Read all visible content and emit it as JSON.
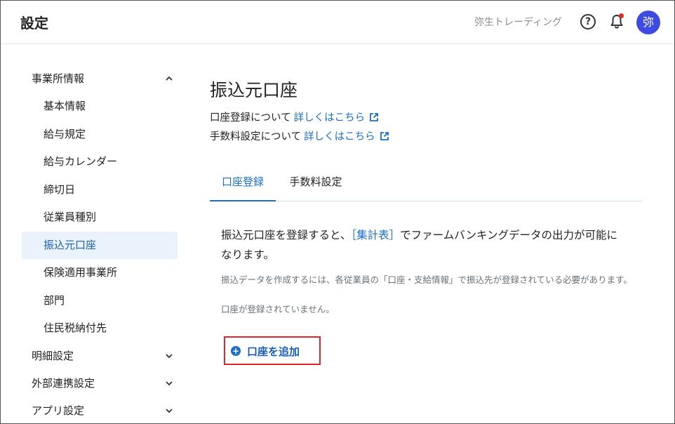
{
  "header": {
    "title": "設定",
    "company": "弥生トレーディング",
    "help_glyph": "?",
    "avatar_initial": "弥",
    "colors": {
      "avatar": "#3d4be0",
      "notification_dot": "#e0262c"
    }
  },
  "sidebar": {
    "groups": [
      {
        "label": "事業所情報",
        "expanded": true,
        "items": [
          {
            "label": "基本情報"
          },
          {
            "label": "給与規定"
          },
          {
            "label": "給与カレンダー"
          },
          {
            "label": "締切日"
          },
          {
            "label": "従業員種別"
          },
          {
            "label": "振込元口座",
            "active": true
          },
          {
            "label": "保険適用事業所"
          },
          {
            "label": "部門"
          },
          {
            "label": "住民税納付先"
          }
        ]
      },
      {
        "label": "明細設定",
        "expanded": false
      },
      {
        "label": "外部連携設定",
        "expanded": false
      },
      {
        "label": "アプリ設定",
        "expanded": false
      }
    ]
  },
  "main": {
    "title": "振込元口座",
    "info_lines": [
      {
        "text": "口座登録について",
        "link": "詳しくはこちら"
      },
      {
        "text": "手数料設定について",
        "link": "詳しくはこちら"
      }
    ],
    "tabs": [
      {
        "label": "口座登録",
        "active": true
      },
      {
        "label": "手数料設定",
        "active": false
      }
    ],
    "description_prefix": "振込元口座を登録すると、",
    "description_bracket": "［集計表］",
    "description_suffix": "でファームバンキングデータの出力が可能になります。",
    "note": "振込データを作成するには、各従業員の「口座・支給情報」で振込先が登録されている必要があります。",
    "empty_state": "口座が登録されていません。",
    "add_button": {
      "label": "口座を追加",
      "icon": "plus-circle-icon"
    }
  },
  "colors": {
    "accent": "#1a6fc9",
    "highlight_border": "#e0262c"
  }
}
